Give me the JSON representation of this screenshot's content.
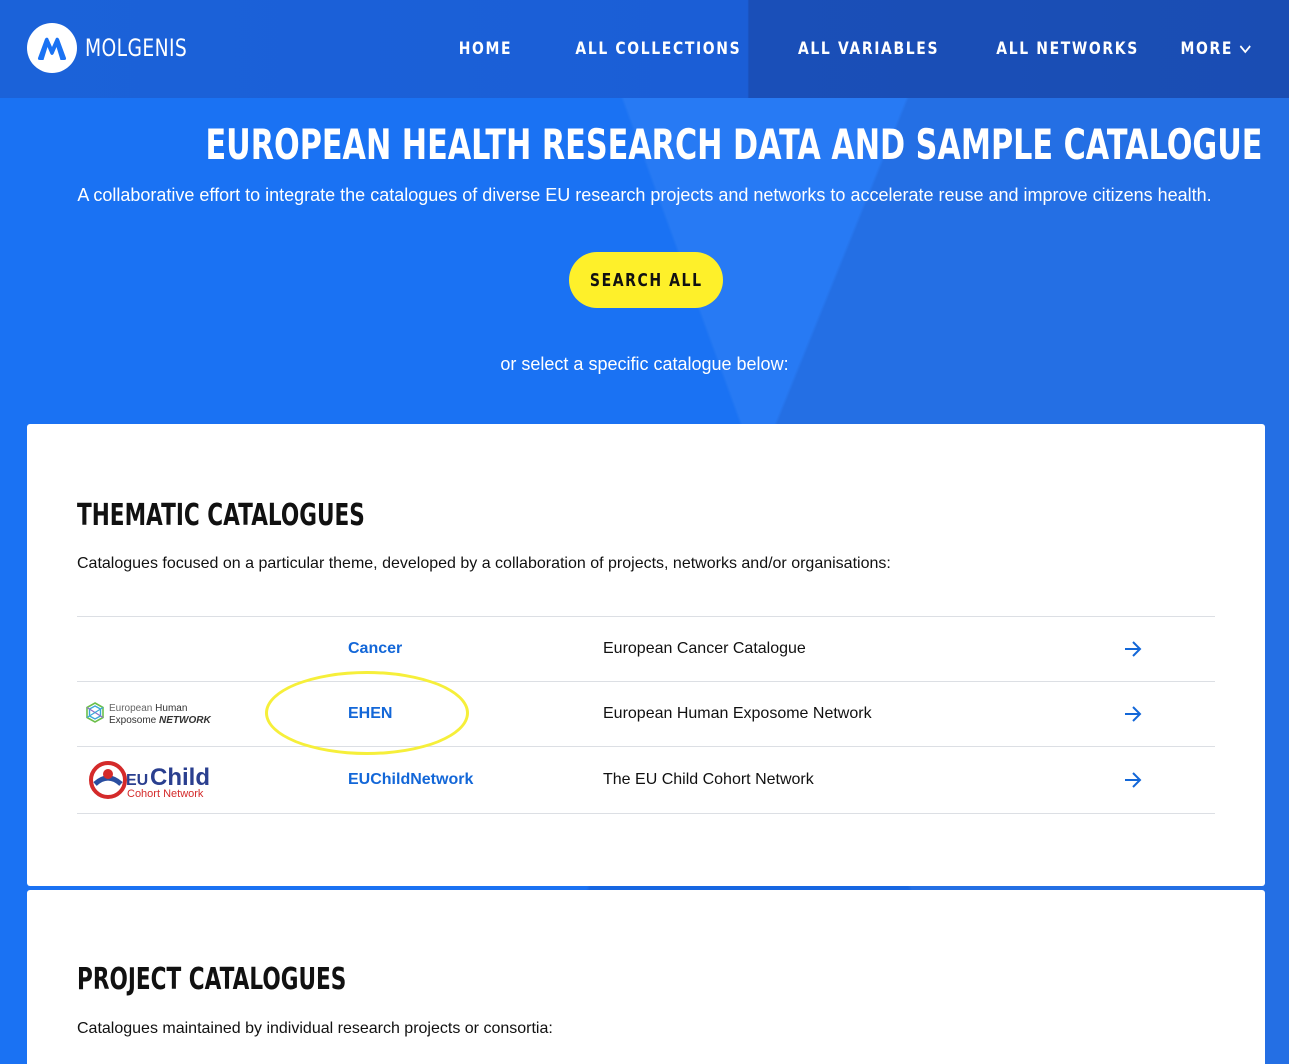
{
  "header": {
    "logo_text": "MOLGENIS",
    "nav": [
      {
        "label": "HOME"
      },
      {
        "label": "ALL COLLECTIONS"
      },
      {
        "label": "ALL VARIABLES"
      },
      {
        "label": "ALL NETWORKS"
      },
      {
        "label": "MORE"
      }
    ]
  },
  "hero": {
    "title": "EUROPEAN HEALTH RESEARCH DATA AND SAMPLE CATALOGUE",
    "subtitle": "A collaborative effort to integrate the catalogues of diverse EU research projects and networks to accelerate reuse and improve citizens health.",
    "search_button": "SEARCH ALL",
    "or_text": "or select a specific catalogue below:"
  },
  "thematic": {
    "heading": "THEMATIC CATALOGUES",
    "description": "Catalogues focused on a particular theme, developed by a collaboration of projects, networks and/or organisations:",
    "rows": [
      {
        "name": "Cancer",
        "description": "European Cancer Catalogue",
        "logo": ""
      },
      {
        "name": "EHEN",
        "description": "European Human Exposome Network",
        "logo": "ehen-logo",
        "logo_line1_a": "European ",
        "logo_line1_b": "Human",
        "logo_line2_a": "Exposome ",
        "logo_line2_b": "NETWORK"
      },
      {
        "name": "EUChildNetwork",
        "description": "The EU Child Cohort Network",
        "logo": "euchild-logo",
        "logo_line1_a": "EU",
        "logo_line1_b": "Child",
        "logo_line2": "Cohort Network"
      }
    ]
  },
  "project": {
    "heading": "PROJECT CATALOGUES",
    "description": "Catalogues maintained by individual research projects or consortia:"
  },
  "colors": {
    "brand_blue": "#1a72f3",
    "button_yellow": "#fef02a",
    "link_blue": "#1367d8",
    "highlight": "#f6ef3a"
  }
}
